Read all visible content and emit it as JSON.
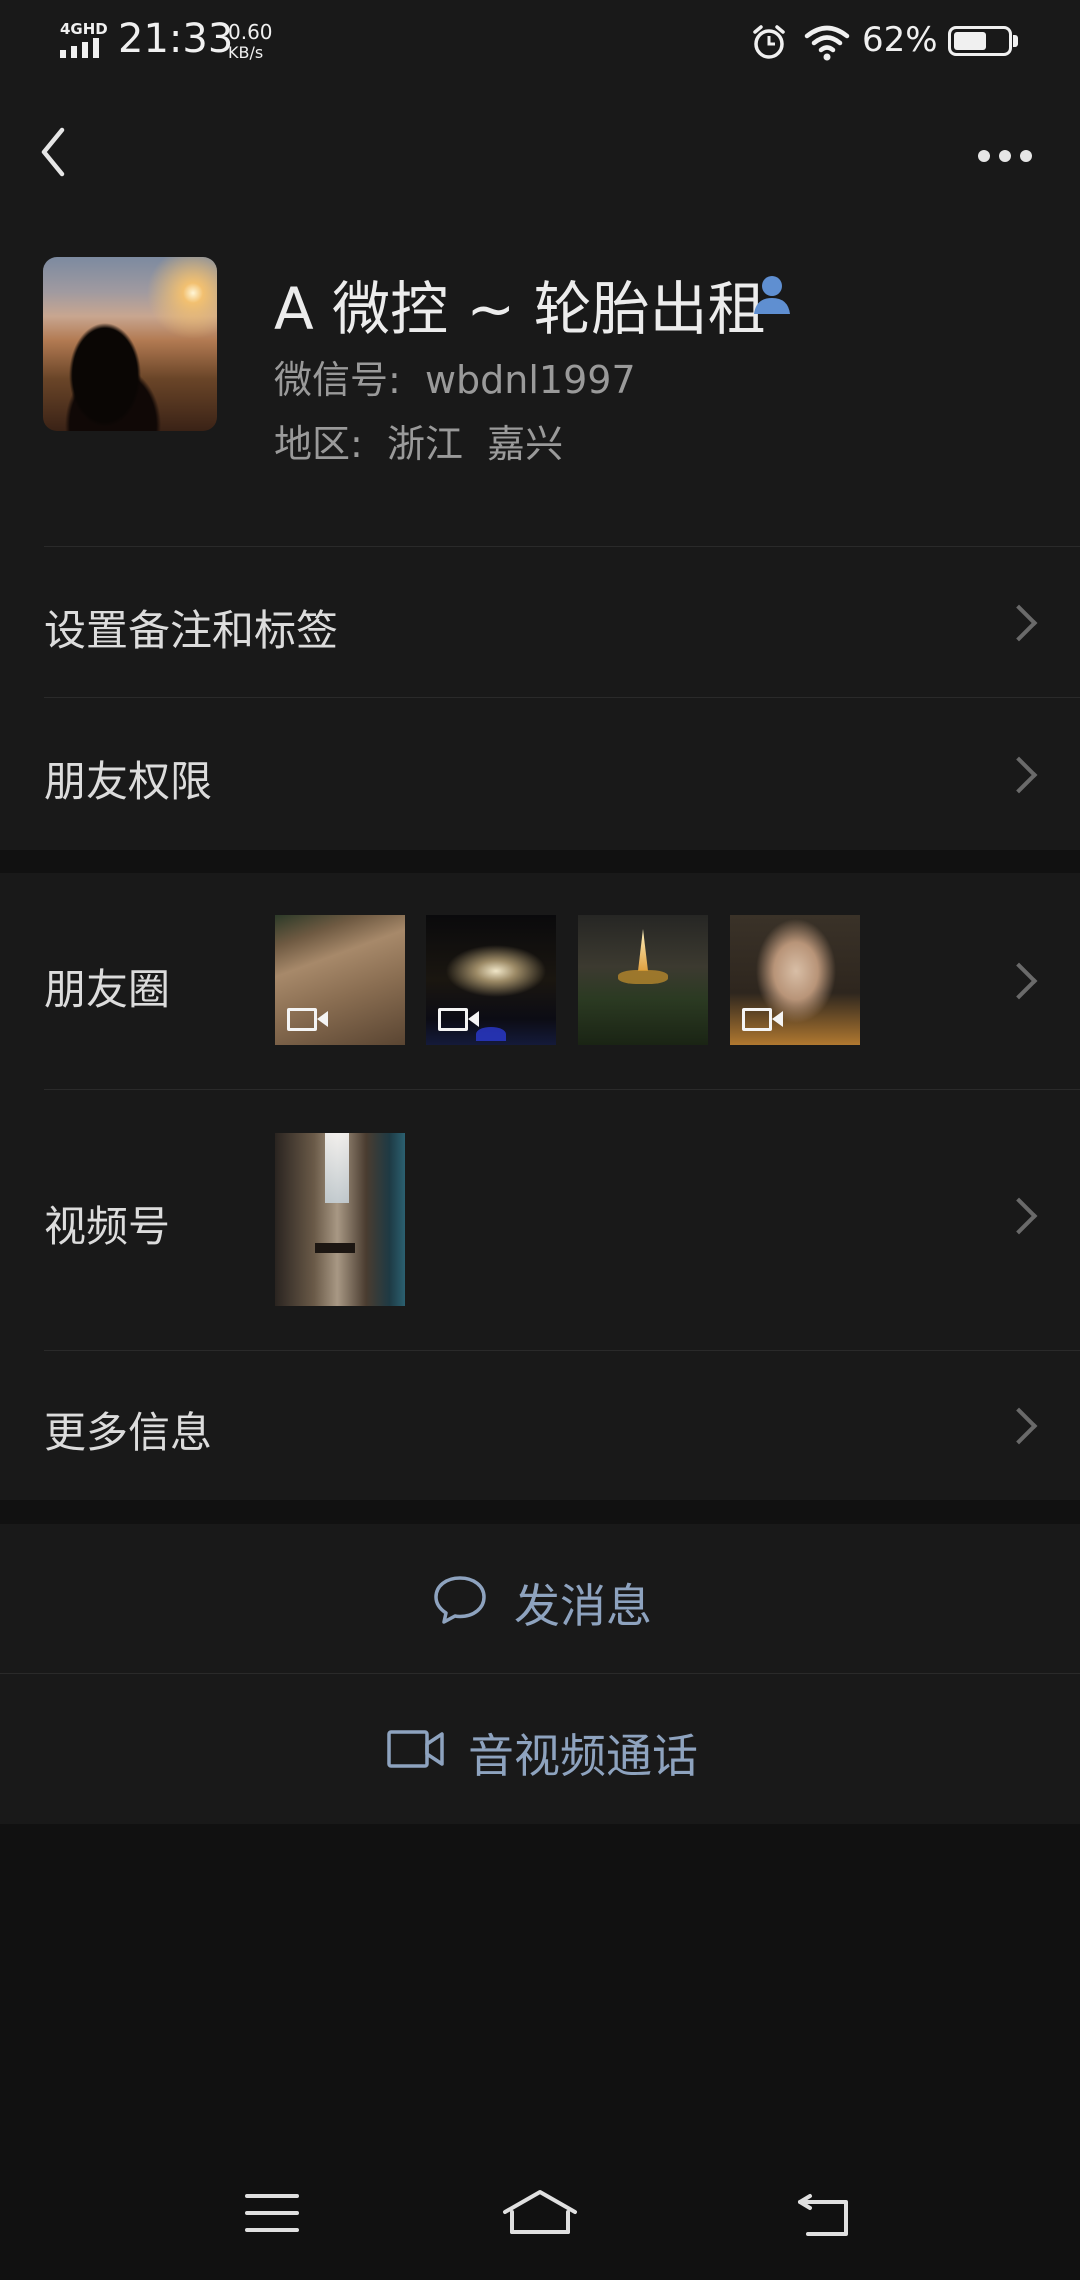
{
  "status_bar": {
    "network": "4GHD",
    "time": "21:33",
    "speed_value": "0.60",
    "speed_unit": "KB/s",
    "battery_percent": "62%",
    "battery_level": 0.62
  },
  "nav": {
    "back_icon": "chevron-left-icon",
    "more_icon": "more-dots-icon"
  },
  "profile": {
    "name": "A 微控 ~ 轮胎出租",
    "wechat_id": "微信号:  wbdnl1997",
    "region": "地区:  浙江  嘉兴",
    "contact_icon": "person-icon"
  },
  "menu": {
    "remark_tags": "设置备注和标签",
    "friend_permissions": "朋友权限",
    "moments": "朋友圈",
    "channels": "视频号",
    "more_info": "更多信息"
  },
  "actions": {
    "send_message": "发消息",
    "av_call": "音视频通话"
  },
  "colors": {
    "background": "#111111",
    "surface": "#191919",
    "accent_text": "#8ea3bf",
    "contact_icon": "#5f8fd1"
  }
}
